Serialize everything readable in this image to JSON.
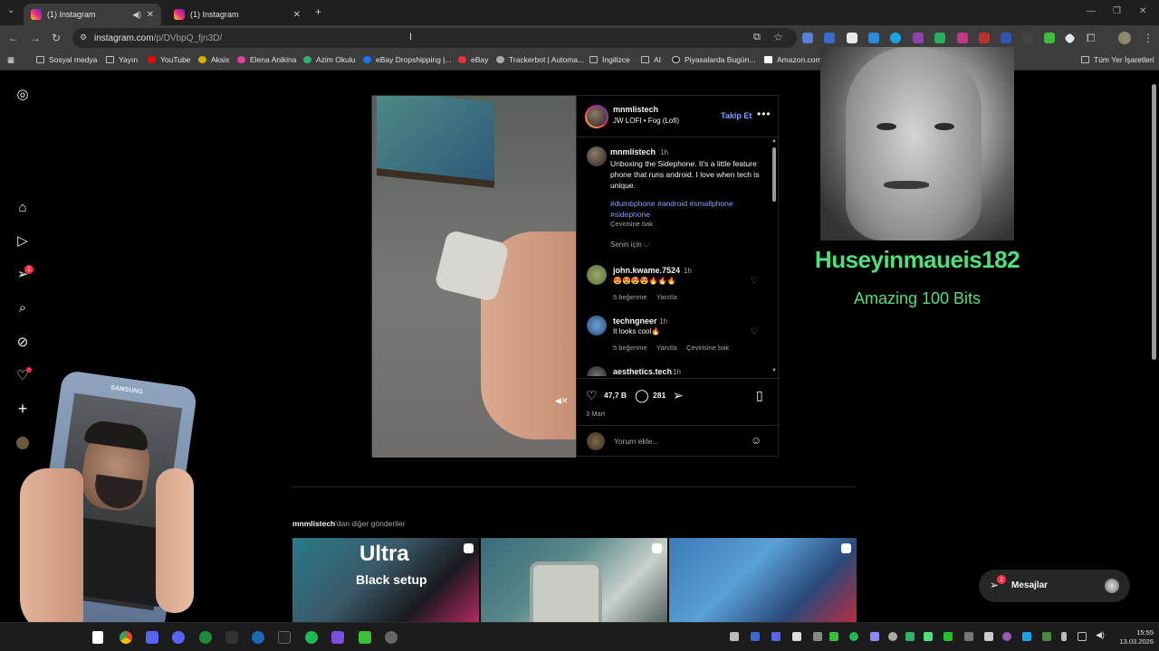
{
  "browser": {
    "tabs": [
      {
        "title": "(1) Instagram",
        "active": true
      },
      {
        "title": "(1) Instagram",
        "active": false
      }
    ],
    "new_tab": "+",
    "url_host": "instagram.com",
    "url_path": "/p/DVbpQ_fjn3D/",
    "bookmarks": [
      "Sosyal medya",
      "Yayın",
      "YouTube",
      "Aksis",
      "Elena Anikina",
      "Azim Okulu",
      "eBay Dropshipping |...",
      "eBay",
      "Trackerbot | Automa...",
      "İngilizce",
      "AI",
      "Piyasalarda Bugün...",
      "Amazon.com..."
    ],
    "all_bookmarks": "Tüm Yer İşaretleri"
  },
  "nav": {
    "messages_badge": "1"
  },
  "post": {
    "author": "mnmlistech",
    "audio": "JW LOFI • Fog (Lofi)",
    "follow_label": "Takip Et",
    "more": "•••",
    "caption_user": "mnmlistech",
    "caption_time": "1h",
    "caption": "Unboxing the Sidephone. It's a little feature phone that runs android. I love when tech is unique.",
    "hashtags": "#dumbphone #android #smallphone #sidephone",
    "see_translation": "Çevirisine bak",
    "for_you": "Senin için ⌵",
    "comments": [
      {
        "user": "john.kwame.7524",
        "time": "1h",
        "text": "😍😍😍😍🔥🔥🔥",
        "likes": "5 beğenme",
        "reply": "Yanıtla",
        "translate": ""
      },
      {
        "user": "techngneer",
        "time": "1h",
        "text": "It looks cool🔥",
        "likes": "5 beğenme",
        "reply": "Yanıtla",
        "translate": "Çevirisine bak"
      },
      {
        "user": "aesthetics.tech",
        "time": "1h",
        "text": "",
        "likes": "",
        "reply": "",
        "translate": ""
      }
    ],
    "likes_count": "47,7 B",
    "comments_count": "281",
    "date": "3 Mart",
    "add_comment_placeholder": "Yorum ekle..."
  },
  "more_posts": {
    "user": "mnmlistech",
    "suffix": "'dan diğer gönderiler",
    "thumb1_line1": "Ultra",
    "thumb1_line2": "Black setup"
  },
  "messages": {
    "label": "Mesajlar",
    "badge": "1"
  },
  "stream_overlay": {
    "donor": "Huseyinmaueis182",
    "amount": "Amazing 100 Bits",
    "phone_brand": "SAMSUNG"
  },
  "taskbar": {
    "time": "15:55",
    "date": "13.03.2026"
  },
  "colors": {
    "accent_link": "#85a1ff",
    "notification": "#ff3040",
    "alert_green": "#4ee07a"
  }
}
